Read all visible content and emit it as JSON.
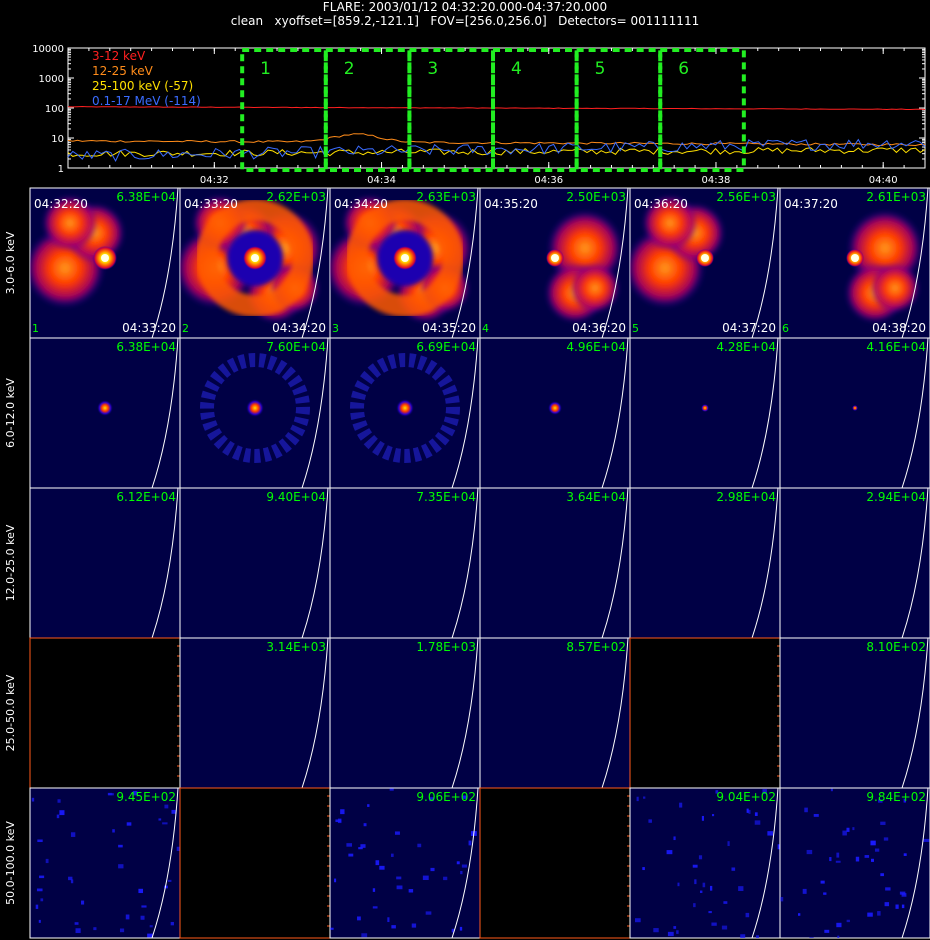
{
  "header": {
    "title": "FLARE: 2003/01/12 04:32:20.000-04:37:20.000",
    "subtitle": "clean   xyoffset=[859.2,-121.1]   FOV=[256.0,256.0]   Detectors= 001111111"
  },
  "colors": {
    "red": "#ff2020",
    "orange": "#ff8c1a",
    "yellow": "#ffe000",
    "blue": "#3a6cff",
    "green": "#00ff00",
    "box": "#22ee22",
    "white": "#ffffff"
  },
  "chart_data": [
    {
      "type": "line",
      "y_scale": "log",
      "ylim": [
        1,
        10000
      ],
      "y_ticks": [
        "1",
        "10",
        "100",
        "1000",
        "10000"
      ],
      "x_ticks": [
        "04:32",
        "04:34",
        "04:36",
        "04:38",
        "04:40"
      ],
      "x_tick_minutes": [
        32,
        34,
        36,
        38,
        40
      ],
      "xlim_minutes": [
        30.25,
        40.5
      ],
      "legend_placement": "top-left",
      "series": [
        {
          "name": "3-12 keV",
          "color": "#ff2020",
          "start": 110,
          "end": 90,
          "noise": 0.02
        },
        {
          "name": "12-25 keV",
          "color": "#ff8c1a",
          "start": 8,
          "end": 6,
          "noise": 0.08,
          "bump_at": 33.7,
          "bump": 12
        },
        {
          "name": "25-100 keV (-57)",
          "color": "#ffe000",
          "start": 3,
          "end": 4,
          "noise": 0.25
        },
        {
          "name": "0.1-17 MeV (-114)",
          "color": "#3a6cff",
          "start": 2.5,
          "end": 7,
          "noise": 0.45
        }
      ],
      "intervals": [
        {
          "label": "1",
          "start": "04:32:20",
          "end": "04:33:20"
        },
        {
          "label": "2",
          "start": "04:33:20",
          "end": "04:34:20"
        },
        {
          "label": "3",
          "start": "04:34:20",
          "end": "04:35:20"
        },
        {
          "label": "4",
          "start": "04:35:20",
          "end": "04:36:20"
        },
        {
          "label": "5",
          "start": "04:36:20",
          "end": "04:37:20"
        },
        {
          "label": "6",
          "start": "04:37:20",
          "end": "04:38:20"
        }
      ]
    },
    {
      "type": "heatmap",
      "columns": [
        {
          "interval": "1",
          "start": "04:32:20",
          "end": "04:33:20"
        },
        {
          "interval": "2",
          "start": "04:33:20",
          "end": "04:34:20"
        },
        {
          "interval": "3",
          "start": "04:34:20",
          "end": "04:35:20"
        },
        {
          "interval": "4",
          "start": "04:35:20",
          "end": "04:36:20"
        },
        {
          "interval": "5",
          "start": "04:36:20",
          "end": "04:37:20"
        },
        {
          "interval": "6",
          "start": "04:37:20",
          "end": "04:38:20"
        }
      ],
      "rows": [
        {
          "label": "3.0-6.0 keV",
          "style": "bright",
          "peaks": [
            "6.38E+04",
            "2.62E+03",
            "2.63E+03",
            "2.50E+03",
            "2.56E+03",
            "2.61E+03"
          ],
          "empty": [
            false,
            false,
            false,
            false,
            false,
            false
          ]
        },
        {
          "label": "6.0-12.0 keV",
          "style": "point",
          "peaks": [
            "6.38E+04",
            "7.60E+04",
            "6.69E+04",
            "4.96E+04",
            "4.28E+04",
            "4.16E+04"
          ],
          "empty": [
            false,
            false,
            false,
            false,
            false,
            false
          ]
        },
        {
          "label": "12.0-25.0 keV",
          "style": "dark",
          "peaks": [
            "6.12E+04",
            "9.40E+04",
            "7.35E+04",
            "3.64E+04",
            "2.98E+04",
            "2.94E+04"
          ],
          "empty": [
            false,
            false,
            false,
            false,
            false,
            false
          ]
        },
        {
          "label": "25.0-50.0 keV",
          "style": "dark",
          "peaks": [
            "",
            "3.14E+03",
            "1.78E+03",
            "8.57E+02",
            "",
            "8.10E+02"
          ],
          "empty": [
            true,
            false,
            false,
            false,
            true,
            false
          ]
        },
        {
          "label": "50.0-100.0 keV",
          "style": "noise",
          "peaks": [
            "9.45E+02",
            "",
            "9.06E+02",
            "",
            "9.04E+02",
            "9.84E+02"
          ],
          "empty": [
            false,
            true,
            false,
            true,
            false,
            false
          ]
        }
      ]
    }
  ]
}
